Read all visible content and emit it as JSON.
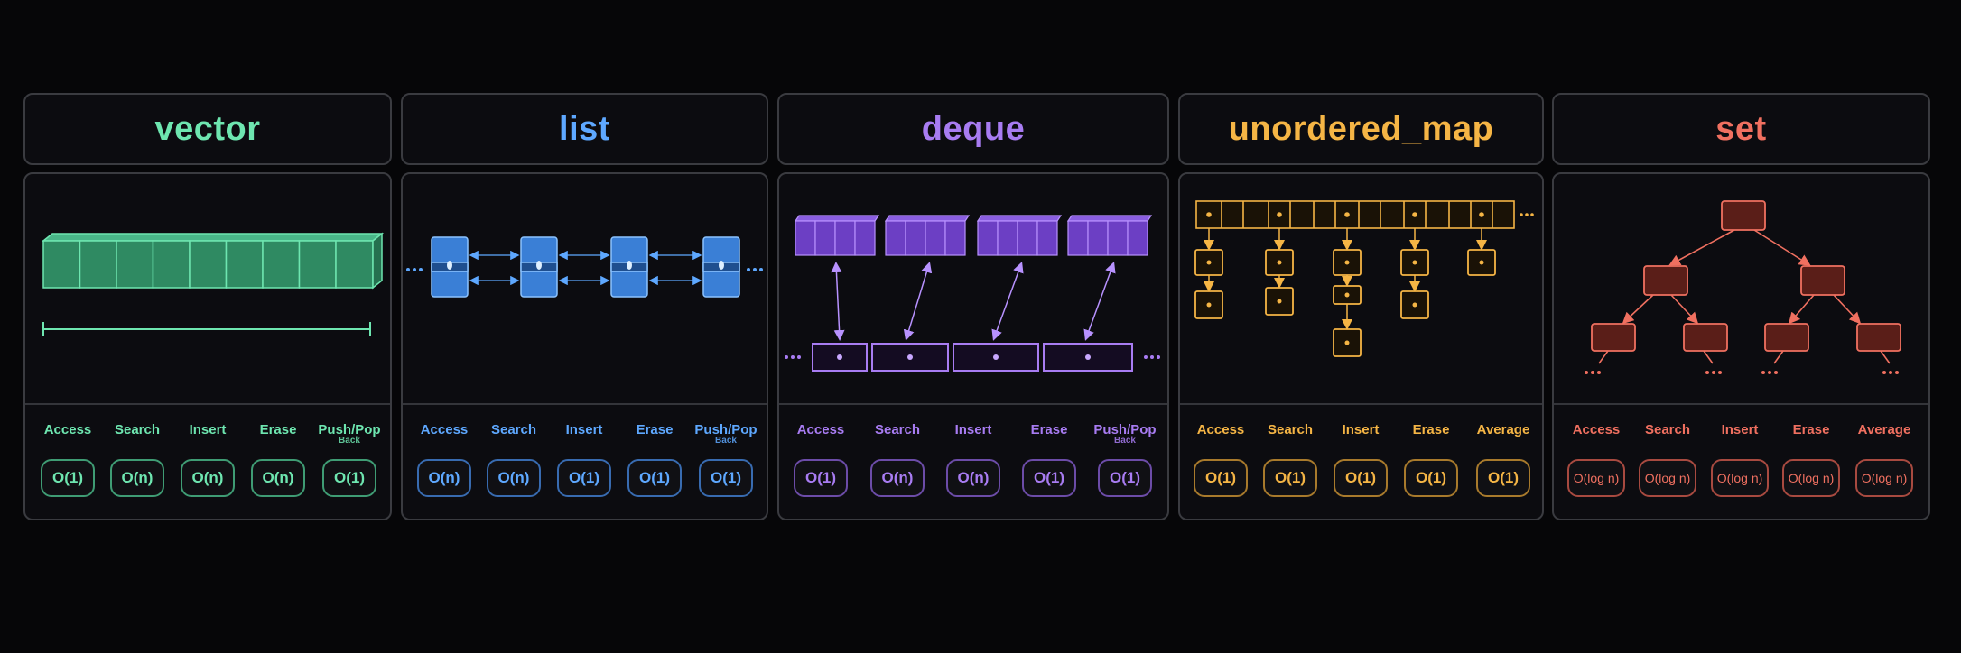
{
  "containers": [
    {
      "name": "vector",
      "color": "#6ee6b0",
      "ops": [
        {
          "label": "Access",
          "sub": "",
          "complexity": "O(1)"
        },
        {
          "label": "Search",
          "sub": "",
          "complexity": "O(n)"
        },
        {
          "label": "Insert",
          "sub": "",
          "complexity": "O(n)"
        },
        {
          "label": "Erase",
          "sub": "",
          "complexity": "O(n)"
        },
        {
          "label": "Push/Pop",
          "sub": "Back",
          "complexity": "O(1)"
        }
      ]
    },
    {
      "name": "list",
      "color": "#5ea8ff",
      "ops": [
        {
          "label": "Access",
          "sub": "",
          "complexity": "O(n)"
        },
        {
          "label": "Search",
          "sub": "",
          "complexity": "O(n)"
        },
        {
          "label": "Insert",
          "sub": "",
          "complexity": "O(1)"
        },
        {
          "label": "Erase",
          "sub": "",
          "complexity": "O(1)"
        },
        {
          "label": "Push/Pop",
          "sub": "Back",
          "complexity": "O(1)"
        }
      ]
    },
    {
      "name": "deque",
      "color": "#a87cf2",
      "ops": [
        {
          "label": "Access",
          "sub": "",
          "complexity": "O(1)"
        },
        {
          "label": "Search",
          "sub": "",
          "complexity": "O(n)"
        },
        {
          "label": "Insert",
          "sub": "",
          "complexity": "O(n)"
        },
        {
          "label": "Erase",
          "sub": "",
          "complexity": "O(1)"
        },
        {
          "label": "Push/Pop",
          "sub": "Back",
          "complexity": "O(1)"
        }
      ]
    },
    {
      "name": "unordered_map",
      "color": "#f5b545",
      "ops": [
        {
          "label": "Access",
          "sub": "",
          "complexity": "O(1)"
        },
        {
          "label": "Search",
          "sub": "",
          "complexity": "O(1)"
        },
        {
          "label": "Insert",
          "sub": "",
          "complexity": "O(1)"
        },
        {
          "label": "Erase",
          "sub": "",
          "complexity": "O(1)"
        },
        {
          "label": "Average",
          "sub": "",
          "complexity": "O(1)"
        }
      ]
    },
    {
      "name": "set",
      "color": "#f07060",
      "ops": [
        {
          "label": "Access",
          "sub": "",
          "complexity": "O(log n)"
        },
        {
          "label": "Search",
          "sub": "",
          "complexity": "O(log n)"
        },
        {
          "label": "Insert",
          "sub": "",
          "complexity": "O(log n)"
        },
        {
          "label": "Erase",
          "sub": "",
          "complexity": "O(log n)"
        },
        {
          "label": "Average",
          "sub": "",
          "complexity": "O(log n)"
        }
      ]
    }
  ]
}
